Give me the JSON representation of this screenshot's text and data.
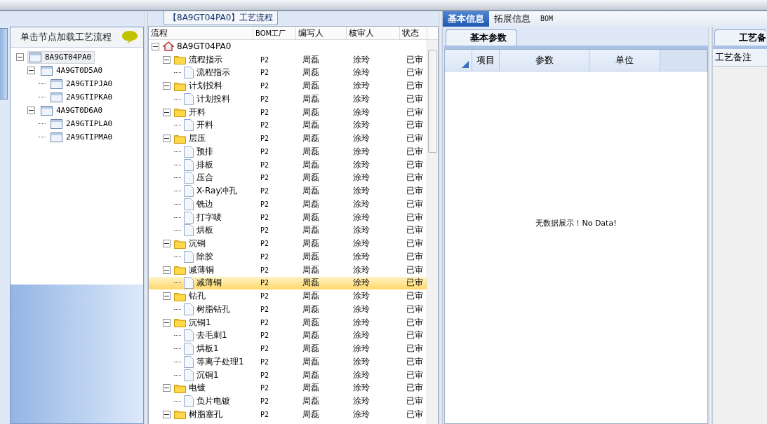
{
  "left_panel": {
    "hint": "单击节点加载工艺流程",
    "tree": [
      {
        "label": "8A9GT04PA0",
        "selected": true,
        "expanded": true,
        "children": [
          {
            "label": "4A9GT0D5A0",
            "selected": false,
            "expanded": true,
            "children": [
              {
                "label": "2A9GTIPJA0",
                "selected": false
              },
              {
                "label": "2A9GTIPKA0",
                "selected": false
              }
            ]
          },
          {
            "label": "4A9GT0D6A0",
            "selected": false,
            "expanded": true,
            "children": [
              {
                "label": "2A9GTIPLA0",
                "selected": false
              },
              {
                "label": "2A9GTIPMA0",
                "selected": false
              }
            ]
          }
        ]
      }
    ]
  },
  "flow": {
    "title": "【8A9GT04PA0】工艺流程",
    "columns": [
      "流程",
      "BOM工厂",
      "编写人",
      "核审人",
      "状态"
    ],
    "rows": [
      {
        "kind": "root",
        "label": "8A9GT04PA0",
        "expanded": true,
        "selected": false,
        "children": [
          {
            "kind": "folder",
            "label": "流程指示",
            "bom": "P2",
            "writer": "周磊",
            "reviewer": "涂玲",
            "status": "已审",
            "expanded": true,
            "selected": false,
            "children": [
              {
                "kind": "file",
                "label": "流程指示",
                "bom": "P2",
                "writer": "周磊",
                "reviewer": "涂玲",
                "status": "已审",
                "selected": false
              }
            ]
          },
          {
            "kind": "folder",
            "label": "计划投料",
            "bom": "P2",
            "writer": "周磊",
            "reviewer": "涂玲",
            "status": "已审",
            "expanded": true,
            "selected": false,
            "children": [
              {
                "kind": "file",
                "label": "计划投料",
                "bom": "P2",
                "writer": "周磊",
                "reviewer": "涂玲",
                "status": "已审",
                "selected": false
              }
            ]
          },
          {
            "kind": "folder",
            "label": "开料",
            "bom": "P2",
            "writer": "周磊",
            "reviewer": "涂玲",
            "status": "已审",
            "expanded": true,
            "selected": false,
            "children": [
              {
                "kind": "file",
                "label": "开料",
                "bom": "P2",
                "writer": "周磊",
                "reviewer": "涂玲",
                "status": "已审",
                "selected": false
              }
            ]
          },
          {
            "kind": "folder",
            "label": "层压",
            "bom": "P2",
            "writer": "周磊",
            "reviewer": "涂玲",
            "status": "已审",
            "expanded": true,
            "selected": false,
            "children": [
              {
                "kind": "file",
                "label": "预排",
                "bom": "P2",
                "writer": "周磊",
                "reviewer": "涂玲",
                "status": "已审",
                "selected": false
              },
              {
                "kind": "file",
                "label": "排板",
                "bom": "P2",
                "writer": "周磊",
                "reviewer": "涂玲",
                "status": "已审",
                "selected": false
              },
              {
                "kind": "file",
                "label": "压合",
                "bom": "P2",
                "writer": "周磊",
                "reviewer": "涂玲",
                "status": "已审",
                "selected": false
              },
              {
                "kind": "file",
                "label": "X-Ray冲孔",
                "bom": "P2",
                "writer": "周磊",
                "reviewer": "涂玲",
                "status": "已审",
                "selected": false
              },
              {
                "kind": "file",
                "label": "铣边",
                "bom": "P2",
                "writer": "周磊",
                "reviewer": "涂玲",
                "status": "已审",
                "selected": false
              },
              {
                "kind": "file",
                "label": "打字唛",
                "bom": "P2",
                "writer": "周磊",
                "reviewer": "涂玲",
                "status": "已审",
                "selected": false
              },
              {
                "kind": "file",
                "label": "烘板",
                "bom": "P2",
                "writer": "周磊",
                "reviewer": "涂玲",
                "status": "已审",
                "selected": false
              }
            ]
          },
          {
            "kind": "folder",
            "label": "沉铜",
            "bom": "P2",
            "writer": "周磊",
            "reviewer": "涂玲",
            "status": "已审",
            "expanded": true,
            "selected": false,
            "children": [
              {
                "kind": "file",
                "label": "除胶",
                "bom": "P2",
                "writer": "周磊",
                "reviewer": "涂玲",
                "status": "已审",
                "selected": false
              }
            ]
          },
          {
            "kind": "folder",
            "label": "减薄铜",
            "bom": "P2",
            "writer": "周磊",
            "reviewer": "涂玲",
            "status": "已审",
            "expanded": true,
            "selected": false,
            "children": [
              {
                "kind": "file",
                "label": "减薄铜",
                "bom": "P2",
                "writer": "周磊",
                "reviewer": "涂玲",
                "status": "已审",
                "selected": true
              }
            ]
          },
          {
            "kind": "folder",
            "label": "钻孔",
            "bom": "P2",
            "writer": "周磊",
            "reviewer": "涂玲",
            "status": "已审",
            "expanded": true,
            "selected": false,
            "children": [
              {
                "kind": "file",
                "label": "树脂钻孔",
                "bom": "P2",
                "writer": "周磊",
                "reviewer": "涂玲",
                "status": "已审",
                "selected": false
              }
            ]
          },
          {
            "kind": "folder",
            "label": "沉铜1",
            "bom": "P2",
            "writer": "周磊",
            "reviewer": "涂玲",
            "status": "已审",
            "expanded": true,
            "selected": false,
            "children": [
              {
                "kind": "file",
                "label": "去毛刺1",
                "bom": "P2",
                "writer": "周磊",
                "reviewer": "涂玲",
                "status": "已审",
                "selected": false
              },
              {
                "kind": "file",
                "label": "烘板1",
                "bom": "P2",
                "writer": "周磊",
                "reviewer": "涂玲",
                "status": "已审",
                "selected": false
              },
              {
                "kind": "file",
                "label": "等离子处理1",
                "bom": "P2",
                "writer": "周磊",
                "reviewer": "涂玲",
                "status": "已审",
                "selected": false
              },
              {
                "kind": "file",
                "label": "沉铜1",
                "bom": "P2",
                "writer": "周磊",
                "reviewer": "涂玲",
                "status": "已审",
                "selected": false
              }
            ]
          },
          {
            "kind": "folder",
            "label": "电镀",
            "bom": "P2",
            "writer": "周磊",
            "reviewer": "涂玲",
            "status": "已审",
            "expanded": true,
            "selected": false,
            "children": [
              {
                "kind": "file",
                "label": "负片电镀",
                "bom": "P2",
                "writer": "周磊",
                "reviewer": "涂玲",
                "status": "已审",
                "selected": false
              }
            ]
          },
          {
            "kind": "folder",
            "label": "树脂塞孔",
            "bom": "P2",
            "writer": "周磊",
            "reviewer": "涂玲",
            "status": "已审",
            "expanded": true,
            "selected": false
          }
        ]
      }
    ]
  },
  "info": {
    "tabs": [
      {
        "label": "基本信息",
        "selected": true
      },
      {
        "label": "拓展信息",
        "selected": false
      },
      {
        "label": "BOM",
        "selected": false
      }
    ],
    "subtab": "基本参数",
    "columns": [
      "项目",
      "参数",
      "单位"
    ],
    "empty": "无数据展示！No Data!"
  },
  "notes": {
    "tab": "工艺备",
    "header": "工艺备注"
  }
}
